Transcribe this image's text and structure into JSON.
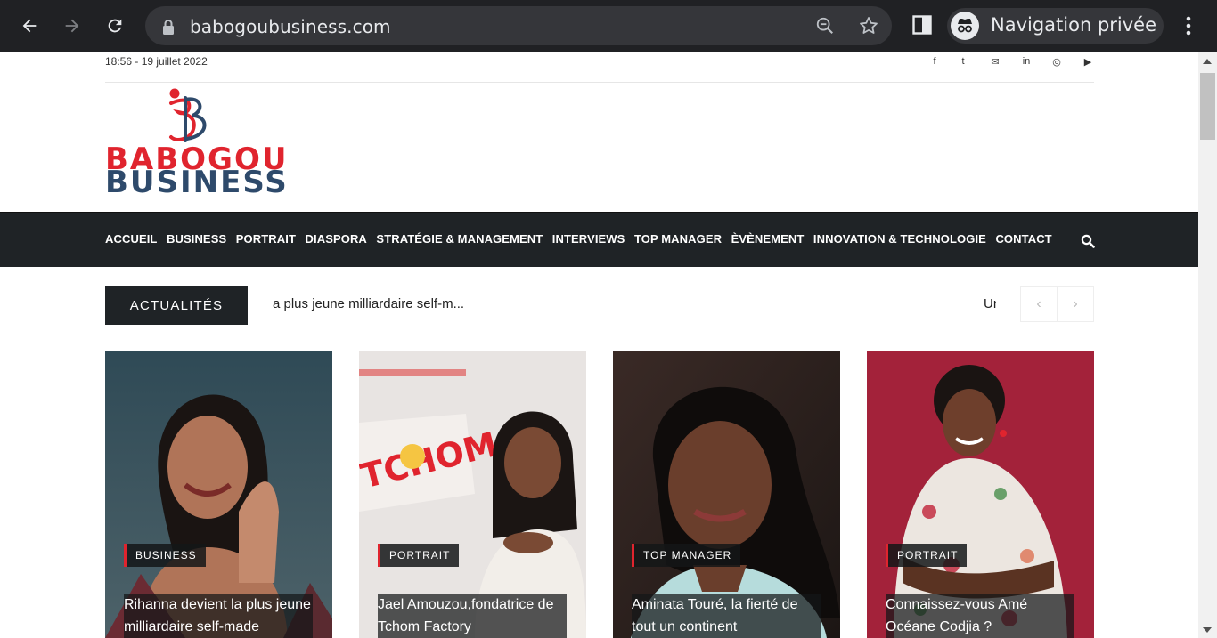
{
  "browser": {
    "url": "babogoubusiness.com",
    "incognito_label": "Navigation privée",
    "icons": [
      "back-icon",
      "forward-icon",
      "reload-icon",
      "lock-icon",
      "zoom-out-icon",
      "star-icon",
      "side-panel-icon",
      "incognito-icon",
      "menu-icon"
    ]
  },
  "topbar": {
    "datetime": "18:56 - 19 juillet 2022",
    "social": [
      {
        "name": "facebook-icon",
        "glyph": "f"
      },
      {
        "name": "twitter-icon",
        "glyph": "t"
      },
      {
        "name": "email-icon",
        "glyph": "✉"
      },
      {
        "name": "linkedin-icon",
        "glyph": "in"
      },
      {
        "name": "instagram-icon",
        "glyph": "◎"
      },
      {
        "name": "youtube-icon",
        "glyph": "▶"
      }
    ]
  },
  "logo": {
    "line1": "BABOGOU",
    "line2": "BUSINESS",
    "colors": {
      "red": "#e0242e",
      "blue": "#2e4a6b"
    }
  },
  "nav": {
    "items": [
      "ACCUEIL",
      "BUSINESS",
      "PORTRAIT",
      "DIASPORA",
      "STRATÉGIE & MANAGEMENT",
      "INTERVIEWS",
      "TOP MANAGER",
      "ÈVÈNEMENT",
      "INNOVATION & TECHNOLOGIE",
      "CONTACT"
    ],
    "bg": "#1f2326"
  },
  "ticker": {
    "label": "ACTUALITÉS",
    "text": "a plus jeune milliardaire self-m...",
    "text2": "Un",
    "prev": "‹",
    "next": "›"
  },
  "cards": [
    {
      "category": "BUSINESS",
      "title": "Rihanna devient la plus jeune milliardaire self-made"
    },
    {
      "category": "PORTRAIT",
      "title": "Jael Amouzou,fondatrice de Tchom Factory"
    },
    {
      "category": "TOP MANAGER",
      "title": "Aminata Touré, la fierté de tout un continent"
    },
    {
      "category": "PORTRAIT",
      "title": "Connaissez-vous Amé Océane Codjia ?"
    }
  ],
  "photo_text": {
    "tchom": "TCHOM"
  }
}
